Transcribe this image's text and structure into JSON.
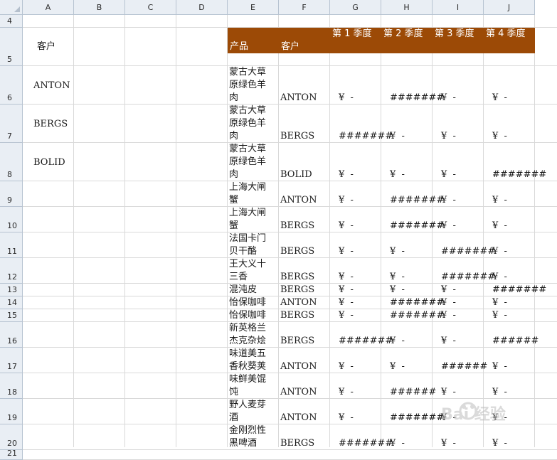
{
  "columns": [
    "A",
    "B",
    "C",
    "D",
    "E",
    "F",
    "G",
    "H",
    "I",
    "J"
  ],
  "rows": [
    {
      "num": "4"
    },
    {
      "num": "5"
    },
    {
      "num": "6"
    },
    {
      "num": "7"
    },
    {
      "num": "8"
    },
    {
      "num": "9"
    },
    {
      "num": "10"
    },
    {
      "num": "11"
    },
    {
      "num": "12"
    },
    {
      "num": "13"
    },
    {
      "num": "14"
    },
    {
      "num": "15"
    },
    {
      "num": "16"
    },
    {
      "num": "17"
    },
    {
      "num": "18"
    },
    {
      "num": "19"
    },
    {
      "num": "20"
    },
    {
      "num": "21"
    }
  ],
  "colA": {
    "header": "客户",
    "items": [
      "ANTON",
      "BERGS",
      "BOLID"
    ]
  },
  "table_header": {
    "product": "产品",
    "customer": "客户",
    "q1": "第 1 季度",
    "q2": "第 2 季度",
    "q3": "第 3 季度",
    "q4": "第 4 季度",
    "color": "#9c4a06"
  },
  "table_rows": [
    {
      "product": "蒙古大草原绿色羊肉",
      "customer": "ANTON",
      "q": [
        "¥  -",
        "#######",
        "¥  -",
        "¥  -"
      ]
    },
    {
      "product": "蒙古大草原绿色羊肉",
      "customer": "BERGS",
      "q": [
        "#######",
        "¥  -",
        "¥  -",
        "¥  -"
      ]
    },
    {
      "product": "蒙古大草原绿色羊肉",
      "customer": "BOLID",
      "q": [
        "¥  -",
        "¥  -",
        "¥  -",
        "#######"
      ]
    },
    {
      "product": "上海大闸蟹",
      "customer": "ANTON",
      "q": [
        "¥  -",
        "#######",
        "¥  -",
        "¥  -"
      ]
    },
    {
      "product": "上海大闸蟹",
      "customer": "BERGS",
      "q": [
        "¥  -",
        "#######",
        "¥  -",
        "¥  -"
      ]
    },
    {
      "product": "法国卡门贝干酪",
      "customer": "BERGS",
      "q": [
        "¥  -",
        "¥  -",
        "#######",
        "¥  -"
      ]
    },
    {
      "product": "王大义十三香",
      "customer": "BERGS",
      "q": [
        "¥  -",
        "¥  -",
        "#######",
        "¥  -"
      ]
    },
    {
      "product": "混沌皮",
      "customer": "BERGS",
      "q": [
        "¥  -",
        "¥  -",
        "¥  -",
        "#######"
      ]
    },
    {
      "product": "怡保咖啡",
      "customer": "ANTON",
      "q": [
        "¥  -",
        "#######",
        "¥  -",
        "¥  -"
      ]
    },
    {
      "product": "怡保咖啡",
      "customer": "BERGS",
      "q": [
        "¥  -",
        "#######",
        "¥  -",
        "¥  -"
      ]
    },
    {
      "product": "新英格兰杰克杂烩",
      "customer": "BERGS",
      "q": [
        "#######",
        "¥  -",
        "¥  -",
        "######"
      ]
    },
    {
      "product": "味道美五香秋葵荚",
      "customer": "ANTON",
      "q": [
        "¥  -",
        "¥  -",
        "######",
        "¥  -"
      ]
    },
    {
      "product": "味鲜美馄饨",
      "customer": "ANTON",
      "q": [
        "¥  -",
        "######",
        "¥  -",
        "¥  -"
      ]
    },
    {
      "product": "野人麦芽酒",
      "customer": "ANTON",
      "q": [
        "¥  -",
        "#######",
        "¥  -",
        "¥  -"
      ]
    },
    {
      "product": "金刚烈性黑啤酒",
      "customer": "BERGS",
      "q": [
        "#######",
        "¥  -",
        "¥  -",
        "¥  -"
      ]
    }
  ],
  "watermark": "Bai 经验"
}
